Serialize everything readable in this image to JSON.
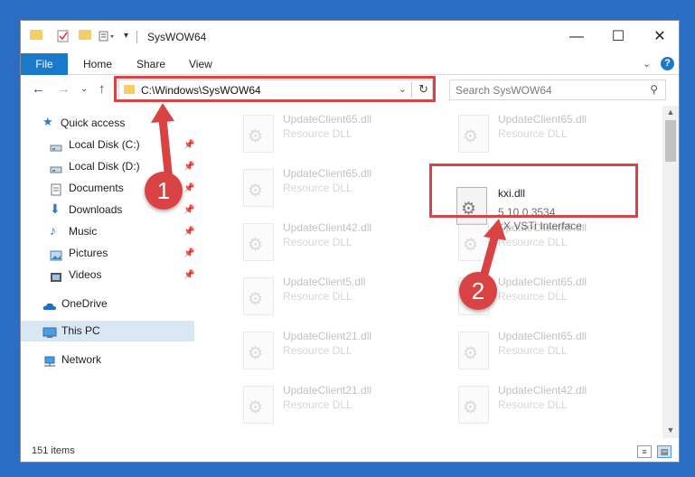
{
  "window": {
    "title": "SysWOW64"
  },
  "titlebar": {
    "minimize": "—",
    "maximize": "☐",
    "close": "✕"
  },
  "ribbon": {
    "tabs": [
      "File",
      "Home",
      "Share",
      "View"
    ],
    "help": "?"
  },
  "address": {
    "path": "C:\\Windows\\SysWOW64",
    "search_placeholder": "Search SysWOW64"
  },
  "nav": {
    "items": [
      {
        "label": "Quick access",
        "icon": "star-icon",
        "pinned": false
      },
      {
        "label": "Local Disk (C:)",
        "icon": "drive-icon",
        "pinned": true
      },
      {
        "label": "Local Disk (D:)",
        "icon": "drive-icon",
        "pinned": true
      },
      {
        "label": "Documents",
        "icon": "documents-icon",
        "pinned": true
      },
      {
        "label": "Downloads",
        "icon": "downloads-icon",
        "pinned": true
      },
      {
        "label": "Music",
        "icon": "music-icon",
        "pinned": true
      },
      {
        "label": "Pictures",
        "icon": "pictures-icon",
        "pinned": true
      },
      {
        "label": "Videos",
        "icon": "videos-icon",
        "pinned": true
      },
      {
        "label": "OneDrive",
        "icon": "onedrive-icon",
        "pinned": false
      },
      {
        "label": "This PC",
        "icon": "pc-icon",
        "pinned": false
      },
      {
        "label": "Network",
        "icon": "network-icon",
        "pinned": false
      }
    ]
  },
  "files": {
    "left": [
      {
        "name": "UpdateClient65.dll",
        "type": "Resource DLL"
      },
      {
        "name": "UpdateClient65.dll",
        "type": "Resource DLL"
      },
      {
        "name": "UpdateClient42.dll",
        "type": "Resource DLL"
      },
      {
        "name": "UpdateClient5.dll",
        "type": "Resource DLL"
      },
      {
        "name": "UpdateClient21.dll",
        "type": "Resource DLL"
      },
      {
        "name": "UpdateClient21.dll",
        "type": "Resource DLL"
      }
    ],
    "right": [
      {
        "name": "UpdateClient65.dll",
        "type": "Resource DLL"
      },
      {
        "name": "UpdateClient65.dll",
        "type": "Resource DLL"
      },
      {
        "name": "UpdateClient65.dll",
        "type": "Resource DLL"
      },
      {
        "name": "UpdateClient65.dll",
        "type": "Resource DLL"
      },
      {
        "name": "UpdateClient42.dll",
        "type": "Resource DLL"
      }
    ],
    "highlighted": {
      "name": "kxi.dll",
      "version": "5.10.0.3534",
      "description": "kX VSTi Interface"
    }
  },
  "status": {
    "count": "151 items"
  },
  "markers": [
    "1",
    "2"
  ],
  "colors": {
    "accent": "#1979ca",
    "annotation": "#d94343",
    "desktop": "#2b6cc4"
  }
}
